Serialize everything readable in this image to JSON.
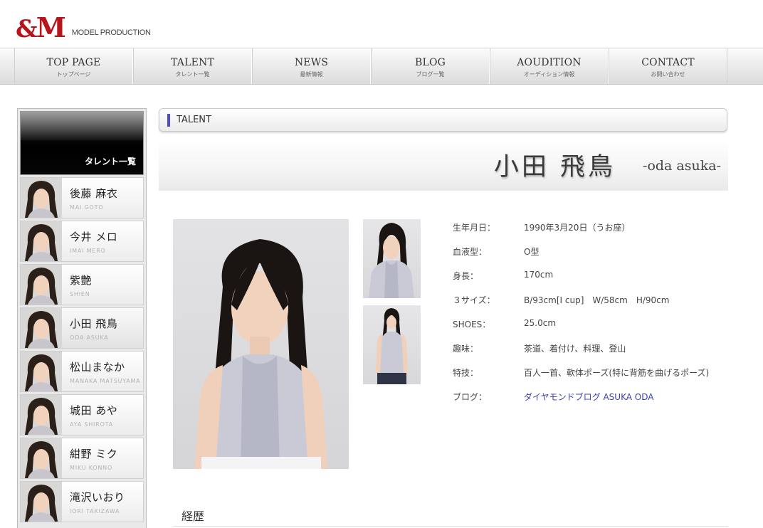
{
  "logo": {
    "mark_amp": "&",
    "mark_m": "M",
    "subtitle": "MODEL PRODUCTION"
  },
  "nav": [
    {
      "en": "TOP PAGE",
      "ja": "トップページ"
    },
    {
      "en": "TALENT",
      "ja": "タレント一覧"
    },
    {
      "en": "NEWS",
      "ja": "最新情報"
    },
    {
      "en": "BLOG",
      "ja": "ブログ一覧"
    },
    {
      "en": "AOUDITION",
      "ja": "オーディション情報"
    },
    {
      "en": "CONTACT",
      "ja": "お問い合わせ"
    }
  ],
  "sidebar": {
    "heading": "タレント一覧",
    "items": [
      {
        "name": "後藤 麻衣",
        "roman": "MAI GOTO"
      },
      {
        "name": "今井 メロ",
        "roman": "IMAI MERO"
      },
      {
        "name": "紫艶",
        "roman": "SHIEN"
      },
      {
        "name": "小田 飛鳥",
        "roman": "ODA ASUKA"
      },
      {
        "name": "松山まなか",
        "roman": "MANAKA MATSUYAMA"
      },
      {
        "name": "城田 あや",
        "roman": "AYA SHIROTA"
      },
      {
        "name": "紺野 ミク",
        "roman": "MIKU KONNO"
      },
      {
        "name": "滝沢いおり",
        "roman": "IORI TAKIZAWA"
      }
    ]
  },
  "section": {
    "label": "TALENT"
  },
  "talent": {
    "name_kanji": "小田 飛鳥",
    "name_roman": "-oda asuka-",
    "profile": [
      {
        "key": "生年月日：",
        "value": "1990年3月20日（うお座）"
      },
      {
        "key": "血液型：",
        "value": "O型"
      },
      {
        "key": "身長：",
        "value": "170cm"
      },
      {
        "key": "３サイズ：",
        "value": "B/93cm[I cup]　W/58cm　H/90cm"
      },
      {
        "key": "SHOES：",
        "value": "25.0cm"
      },
      {
        "key": "趣味：",
        "value": "茶道、着付け、料理、登山"
      },
      {
        "key": "特技：",
        "value": "百人一首、軟体ポーズ(特に背筋を曲げるポーズ)"
      },
      {
        "key": "ブログ：",
        "value": "ダイヤモンドブログ ASUKA ODA"
      }
    ]
  },
  "career": {
    "heading": "経歴"
  },
  "colors": {
    "brand_red": "#b8141b",
    "accent_blue": "#4b4fc1",
    "link": "#3b3fb6"
  }
}
